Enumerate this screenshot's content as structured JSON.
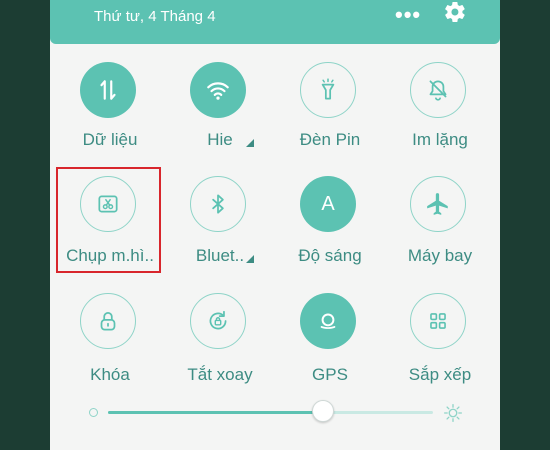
{
  "header": {
    "date": "Thứ tư, 4 Tháng 4",
    "more_label": "•••"
  },
  "colors": {
    "accent": "#5cc2b2",
    "label": "#3d8c83",
    "highlight": "#d8262c",
    "background": "#1c3d33"
  },
  "tiles": [
    {
      "label": "Dữ liệu",
      "icon": "mobile-data-icon",
      "state": "on"
    },
    {
      "label": "Hie",
      "icon": "wifi-icon",
      "state": "on",
      "has_more": true
    },
    {
      "label": "Đèn Pin",
      "icon": "flashlight-icon",
      "state": "off"
    },
    {
      "label": "Im lặng",
      "icon": "bell-off-icon",
      "state": "off"
    },
    {
      "label": "Chụp m.hì..",
      "icon": "screenshot-icon",
      "state": "off",
      "highlighted": true
    },
    {
      "label": "Bluet..",
      "icon": "bluetooth-icon",
      "state": "off",
      "has_more": true
    },
    {
      "label": "Độ sáng",
      "icon": "brightness-auto-icon",
      "state": "on",
      "icon_text": "A"
    },
    {
      "label": "Máy bay",
      "icon": "airplane-icon",
      "state": "off"
    },
    {
      "label": "Khóa",
      "icon": "lock-icon",
      "state": "off"
    },
    {
      "label": "Tắt xoay",
      "icon": "rotation-lock-icon",
      "state": "off"
    },
    {
      "label": "GPS",
      "icon": "gps-icon",
      "state": "on"
    },
    {
      "label": "Sắp xếp",
      "icon": "grid-icon",
      "state": "off"
    }
  ],
  "brightness": {
    "level": 0.66,
    "min_icon": "dim-icon",
    "max_icon": "sun-icon"
  }
}
